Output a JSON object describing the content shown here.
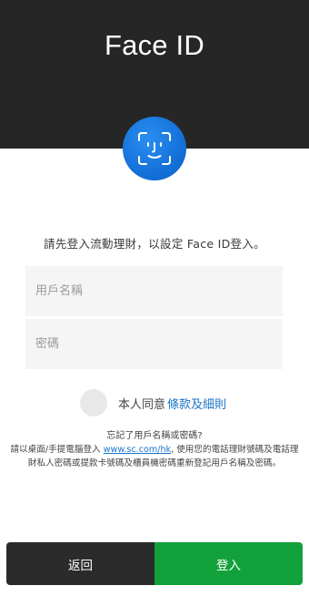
{
  "header": {
    "title": "Face ID"
  },
  "icons": {
    "face_id": "face-id-icon"
  },
  "intro_text": "請先登入流動理財，以設定 Face ID登入。",
  "form": {
    "username_placeholder": "用戶名稱",
    "password_placeholder": "密碼"
  },
  "agreement": {
    "prefix": "本人同意",
    "link_label": "條款及細則"
  },
  "forgot_text": "忘記了用戶名稱或密碼?",
  "help": {
    "before_link": "請以桌面/手提電腦登入 ",
    "link": "www.sc.com/hk",
    "after_link": ", 使用您的電話理財號碼及電話理財私人密碼或提款卡號碼及櫃員機密碼重新登記用戶名稱及密碼。"
  },
  "buttons": {
    "back_label": "返回",
    "login_label": "登入"
  },
  "colors": {
    "header_bg": "#262626",
    "accent_blue": "#1471d9",
    "login_green": "#12a13a",
    "back_dark": "#2b2b2b",
    "link_blue": "#1a73c9"
  }
}
